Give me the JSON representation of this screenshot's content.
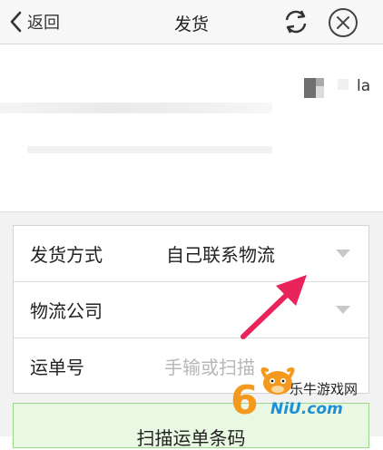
{
  "header": {
    "back_label": "返回",
    "title": "发货"
  },
  "info": {
    "partial_text": "la"
  },
  "form": {
    "rows": [
      {
        "label": "发货方式",
        "value": "自己联系物流"
      },
      {
        "label": "物流公司",
        "value": ""
      },
      {
        "label": "运单号",
        "placeholder": "手输或扫描"
      }
    ],
    "scan_button_label": "扫描运单条码"
  },
  "watermark": {
    "site_name": "乐牛游戏网",
    "url_text": "NiU.com",
    "logo_digit": "6"
  },
  "colors": {
    "header_bg": "#f7f7f7",
    "panel_bg": "#f2f2f2",
    "scan_button_bg": "#e9f8e2",
    "scan_button_border": "#9cd88a",
    "annotation_arrow": "#e8245a",
    "watermark_blue": "#1e8fd6",
    "watermark_orange": "#f39a1e"
  },
  "icons": {
    "back": "chevron-left-icon",
    "refresh": "refresh-icon",
    "close": "close-circle-icon",
    "dropdown": "caret-down-icon"
  }
}
